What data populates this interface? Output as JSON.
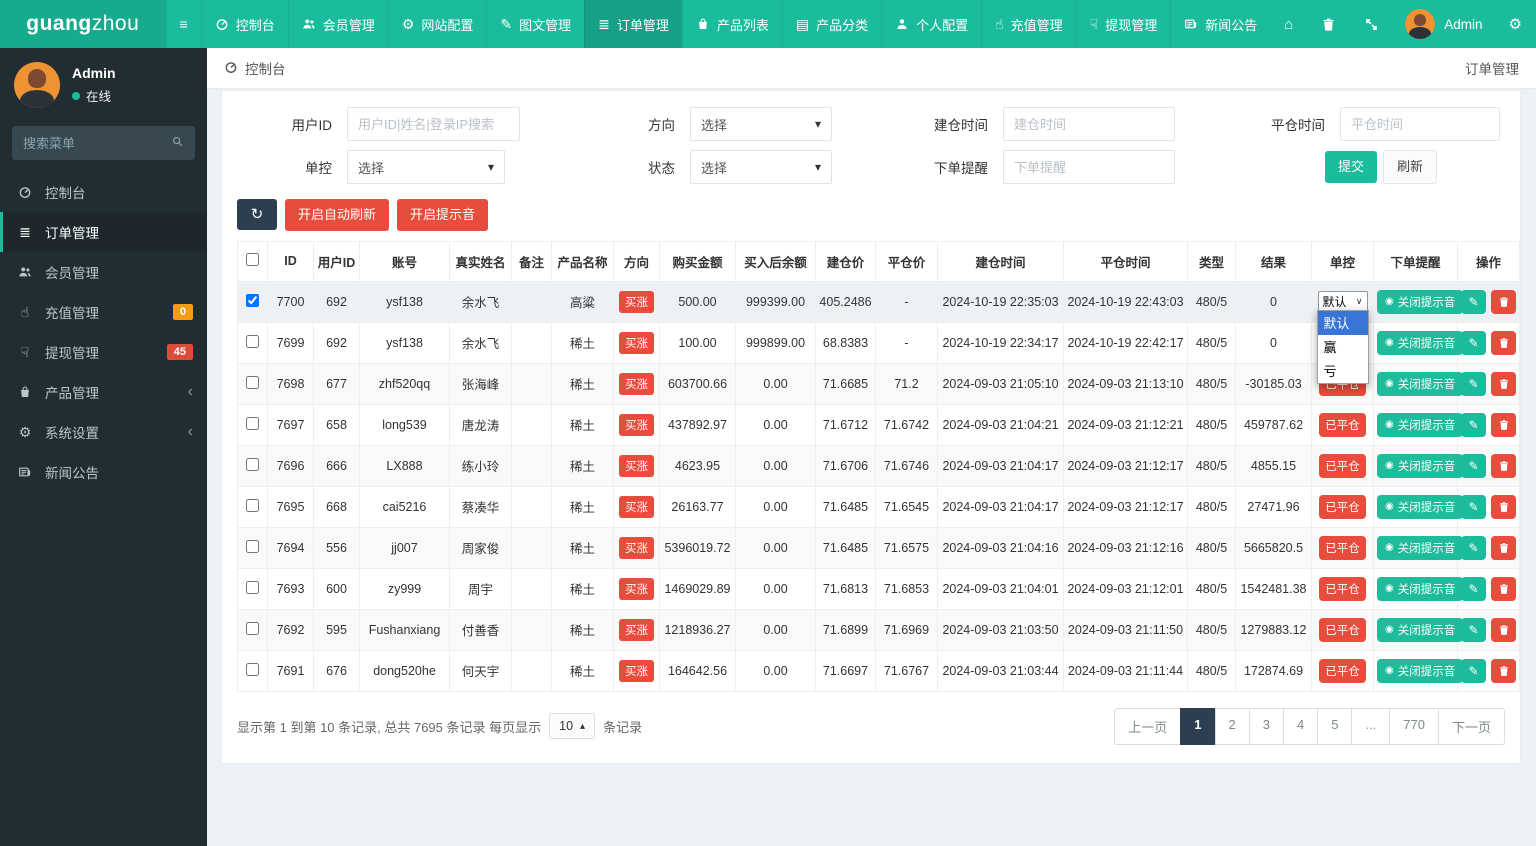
{
  "colors": {
    "accent": "#1abc9c",
    "nav_active": "#16a085",
    "danger": "#e74c3c",
    "dark": "#2c3e50",
    "badge_orange": "#f39c12",
    "badge_red": "#dd4b39",
    "select_highlight": "#3875d7",
    "sidebar_bg": "#222d32"
  },
  "brand": {
    "bold": "guang",
    "light": "zhou"
  },
  "navbar": {
    "menu": [
      {
        "label": "控制台",
        "icon": "gauge"
      },
      {
        "label": "会员管理",
        "icon": "users"
      },
      {
        "label": "网站配置",
        "icon": "gear"
      },
      {
        "label": "图文管理",
        "icon": "pen"
      },
      {
        "label": "订单管理",
        "icon": "list",
        "active": true
      },
      {
        "label": "产品列表",
        "icon": "bag"
      },
      {
        "label": "产品分类",
        "icon": "grid"
      },
      {
        "label": "个人配置",
        "icon": "user"
      },
      {
        "label": "充值管理",
        "icon": "hand-up"
      },
      {
        "label": "提现管理",
        "icon": "hand-down"
      },
      {
        "label": "新闻公告",
        "icon": "news"
      }
    ],
    "right_icons": [
      "home",
      "trash",
      "expand"
    ],
    "user": {
      "name": "Admin"
    }
  },
  "sidebar": {
    "user": {
      "name": "Admin",
      "status": "在线"
    },
    "search_placeholder": "搜索菜单",
    "items": [
      {
        "label": "控制台",
        "icon": "gauge"
      },
      {
        "label": "订单管理",
        "icon": "list",
        "active": true
      },
      {
        "label": "会员管理",
        "icon": "users"
      },
      {
        "label": "充值管理",
        "icon": "hand-up",
        "badge": "0",
        "badge_color": "orange"
      },
      {
        "label": "提现管理",
        "icon": "hand-down",
        "badge": "45",
        "badge_color": "red"
      },
      {
        "label": "产品管理",
        "icon": "bag",
        "expandable": true
      },
      {
        "label": "系统设置",
        "icon": "gears",
        "expandable": true
      },
      {
        "label": "新闻公告",
        "icon": "news"
      }
    ]
  },
  "header": {
    "breadcrumb": "控制台",
    "page_title": "订单管理"
  },
  "filters": {
    "user_id": {
      "label": "用户ID",
      "placeholder": "用户ID|姓名|登录IP搜索"
    },
    "direction": {
      "label": "方向",
      "value": "选择"
    },
    "open_time": {
      "label": "建仓时间",
      "placeholder": "建仓时间"
    },
    "close_time": {
      "label": "平仓时间",
      "placeholder": "平仓时间"
    },
    "control": {
      "label": "单控",
      "value": "选择"
    },
    "status": {
      "label": "状态",
      "value": "选择"
    },
    "remind": {
      "label": "下单提醒",
      "placeholder": "下单提醒"
    },
    "submit": "提交",
    "refresh": "刷新"
  },
  "toolbar": {
    "auto_refresh": "开启自动刷新",
    "sound": "开启提示音"
  },
  "table": {
    "columns": [
      "ID",
      "用户ID",
      "账号",
      "真实姓名",
      "备注",
      "产品名称",
      "方向",
      "购买金额",
      "买入后余额",
      "建仓价",
      "平仓价",
      "建仓时间",
      "平仓时间",
      "类型",
      "结果",
      "单控",
      "下单提醒",
      "操作"
    ],
    "direction_badge": "买涨",
    "closed_badge": "已平仓",
    "sound_button": "关闭提示音",
    "control_default": "默认",
    "control_options": [
      "默认",
      "赢",
      "亏"
    ],
    "rows": [
      {
        "id": "7700",
        "uid": "692",
        "account": "ysf138",
        "real_name": "余水飞",
        "note": "",
        "product": "高粱",
        "amount": "500.00",
        "balance": "999399.00",
        "open_price": "405.2486",
        "close_price": "-",
        "open_time": "2024-10-19 22:35:03",
        "close_time": "2024-10-19 22:43:03",
        "type": "480/5",
        "result": "0",
        "control": "default",
        "checked": true,
        "dropdown_open": true
      },
      {
        "id": "7699",
        "uid": "692",
        "account": "ysf138",
        "real_name": "余水飞",
        "note": "",
        "product": "稀土",
        "amount": "100.00",
        "balance": "999899.00",
        "open_price": "68.8383",
        "close_price": "-",
        "open_time": "2024-10-19 22:34:17",
        "close_time": "2024-10-19 22:42:17",
        "type": "480/5",
        "result": "0",
        "control": "default",
        "checked": false,
        "dropdown_open": false
      },
      {
        "id": "7698",
        "uid": "677",
        "account": "zhf520qq",
        "real_name": "张海峰",
        "note": "",
        "product": "稀土",
        "amount": "603700.66",
        "balance": "0.00",
        "open_price": "71.6685",
        "close_price": "71.2",
        "open_time": "2024-09-03 21:05:10",
        "close_time": "2024-09-03 21:13:10",
        "type": "480/5",
        "result": "-30185.03",
        "control": "closed",
        "checked": false,
        "dropdown_open": false
      },
      {
        "id": "7697",
        "uid": "658",
        "account": "long539",
        "real_name": "唐龙涛",
        "note": "",
        "product": "稀土",
        "amount": "437892.97",
        "balance": "0.00",
        "open_price": "71.6712",
        "close_price": "71.6742",
        "open_time": "2024-09-03 21:04:21",
        "close_time": "2024-09-03 21:12:21",
        "type": "480/5",
        "result": "459787.62",
        "control": "closed",
        "checked": false,
        "dropdown_open": false
      },
      {
        "id": "7696",
        "uid": "666",
        "account": "LX888",
        "real_name": "练小玲",
        "note": "",
        "product": "稀土",
        "amount": "4623.95",
        "balance": "0.00",
        "open_price": "71.6706",
        "close_price": "71.6746",
        "open_time": "2024-09-03 21:04:17",
        "close_time": "2024-09-03 21:12:17",
        "type": "480/5",
        "result": "4855.15",
        "control": "closed",
        "checked": false,
        "dropdown_open": false
      },
      {
        "id": "7695",
        "uid": "668",
        "account": "cai5216",
        "real_name": "蔡凑华",
        "note": "",
        "product": "稀土",
        "amount": "26163.77",
        "balance": "0.00",
        "open_price": "71.6485",
        "close_price": "71.6545",
        "open_time": "2024-09-03 21:04:17",
        "close_time": "2024-09-03 21:12:17",
        "type": "480/5",
        "result": "27471.96",
        "control": "closed",
        "checked": false,
        "dropdown_open": false
      },
      {
        "id": "7694",
        "uid": "556",
        "account": "jj007",
        "real_name": "周家俊",
        "note": "",
        "product": "稀土",
        "amount": "5396019.72",
        "balance": "0.00",
        "open_price": "71.6485",
        "close_price": "71.6575",
        "open_time": "2024-09-03 21:04:16",
        "close_time": "2024-09-03 21:12:16",
        "type": "480/5",
        "result": "5665820.5",
        "control": "closed",
        "checked": false,
        "dropdown_open": false
      },
      {
        "id": "7693",
        "uid": "600",
        "account": "zy999",
        "real_name": "周宇",
        "note": "",
        "product": "稀土",
        "amount": "1469029.89",
        "balance": "0.00",
        "open_price": "71.6813",
        "close_price": "71.6853",
        "open_time": "2024-09-03 21:04:01",
        "close_time": "2024-09-03 21:12:01",
        "type": "480/5",
        "result": "1542481.38",
        "control": "closed",
        "checked": false,
        "dropdown_open": false
      },
      {
        "id": "7692",
        "uid": "595",
        "account": "Fushanxiang",
        "real_name": "付善香",
        "note": "",
        "product": "稀土",
        "amount": "1218936.27",
        "balance": "0.00",
        "open_price": "71.6899",
        "close_price": "71.6969",
        "open_time": "2024-09-03 21:03:50",
        "close_time": "2024-09-03 21:11:50",
        "type": "480/5",
        "result": "1279883.12",
        "control": "closed",
        "checked": false,
        "dropdown_open": false
      },
      {
        "id": "7691",
        "uid": "676",
        "account": "dong520he",
        "real_name": "何天宇",
        "note": "",
        "product": "稀土",
        "amount": "164642.56",
        "balance": "0.00",
        "open_price": "71.6697",
        "close_price": "71.6767",
        "open_time": "2024-09-03 21:03:44",
        "close_time": "2024-09-03 21:11:44",
        "type": "480/5",
        "result": "172874.69",
        "control": "closed",
        "checked": false,
        "dropdown_open": false
      }
    ]
  },
  "pagination": {
    "prefix": "显示第 1 到第 10 条记录, 总共 7695 条记录 每页显示",
    "page_size": "10",
    "suffix": "条记录",
    "prev": "上一页",
    "pages": [
      "1",
      "2",
      "3",
      "4",
      "5",
      "...",
      "770"
    ],
    "active_page": "1",
    "next": "下一页"
  }
}
